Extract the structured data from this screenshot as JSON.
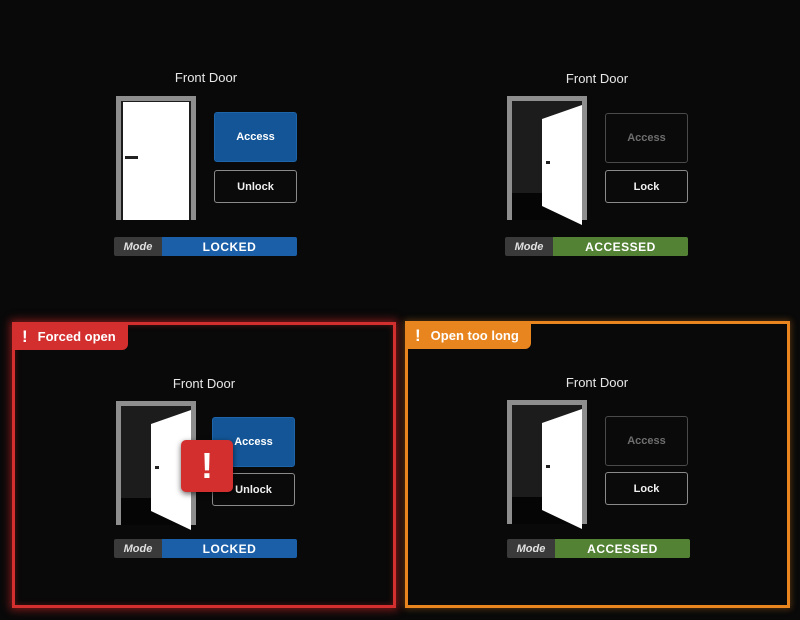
{
  "colors": {
    "background": "#090909",
    "access_blue": "#135596",
    "locked_blue": "#1a5fa8",
    "accessed_green": "#548235",
    "alarm_red": "#d42f2f",
    "alarm_orange": "#e8851e",
    "door_white": "#ffffff",
    "frame_gray": "#8e8e8e"
  },
  "panels": [
    {
      "title": "Front Door",
      "door_state": "closed",
      "access_label": "Access",
      "access_enabled": true,
      "toggle_label": "Unlock",
      "mode_label": "Mode",
      "mode_value": "LOCKED",
      "alarm": null
    },
    {
      "title": "Front Door",
      "door_state": "open",
      "access_label": "Access",
      "access_enabled": false,
      "toggle_label": "Lock",
      "mode_label": "Mode",
      "mode_value": "ACCESSED",
      "alarm": null
    },
    {
      "title": "Front Door",
      "door_state": "open",
      "access_label": "Access",
      "access_enabled": true,
      "toggle_label": "Unlock",
      "mode_label": "Mode",
      "mode_value": "LOCKED",
      "alarm": {
        "icon": "exclamation-icon",
        "label": "Forced open",
        "color": "#d42f2f",
        "overlay_icon": "!"
      }
    },
    {
      "title": "Front Door",
      "door_state": "open",
      "access_label": "Access",
      "access_enabled": false,
      "toggle_label": "Lock",
      "mode_label": "Mode",
      "mode_value": "ACCESSED",
      "alarm": {
        "icon": "exclamation-icon",
        "label": "Open too long",
        "color": "#e8851e"
      }
    }
  ]
}
